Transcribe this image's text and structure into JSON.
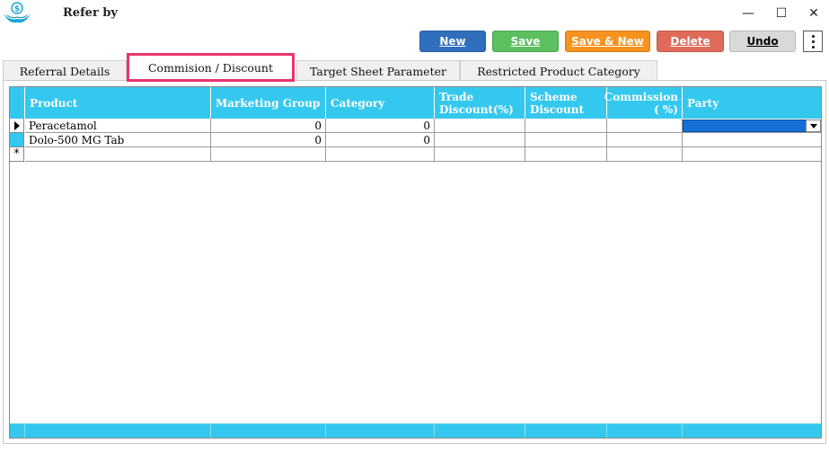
{
  "window": {
    "title": "Refer by",
    "logo_icon": "dollar-hands-logo",
    "controls": {
      "minimize": "—",
      "maximize": "☐",
      "close": "✕"
    }
  },
  "toolbar": {
    "new_label": "New",
    "save_label": "Save",
    "save_new_label": "Save & New",
    "delete_label": "Delete",
    "undo_label": "Undo",
    "more_icon": "vertical-dots-icon"
  },
  "tabs": [
    {
      "label": "Referral Details",
      "active": false
    },
    {
      "label": "Commision / Discount",
      "active": true
    },
    {
      "label": "Target Sheet Parameter",
      "active": false
    },
    {
      "label": "Restricted Product Category",
      "active": false
    }
  ],
  "grid": {
    "columns": [
      "Product",
      "Marketing Group",
      "Category",
      "Trade Discount(%)",
      "Scheme Discount",
      "Commission ( %)",
      "Party"
    ],
    "column_lines": {
      "trade_1": "Trade",
      "trade_2": "Discount(%)",
      "scheme_1": "Scheme",
      "scheme_2": "Discount",
      "commission_1": "Commission",
      "commission_2": "( %)"
    },
    "rows": [
      {
        "product": "Peracetamol",
        "marketing_group": "0",
        "category": "0",
        "trade_discount": "",
        "scheme_discount": "",
        "commission": "",
        "party": ""
      },
      {
        "product": "Dolo-500 MG Tab",
        "marketing_group": "0",
        "category": "0",
        "trade_discount": "",
        "scheme_discount": "",
        "commission": "",
        "party": ""
      }
    ],
    "new_row_marker": "*"
  },
  "colors": {
    "header": "#35c8ef",
    "new": "#2f6fbc",
    "save": "#5cbf60",
    "save_new": "#f7921e",
    "delete": "#e06a5a",
    "undo": "#d9d9d9",
    "active_tab_border": "#e8336d",
    "selection": "#1470d6"
  }
}
